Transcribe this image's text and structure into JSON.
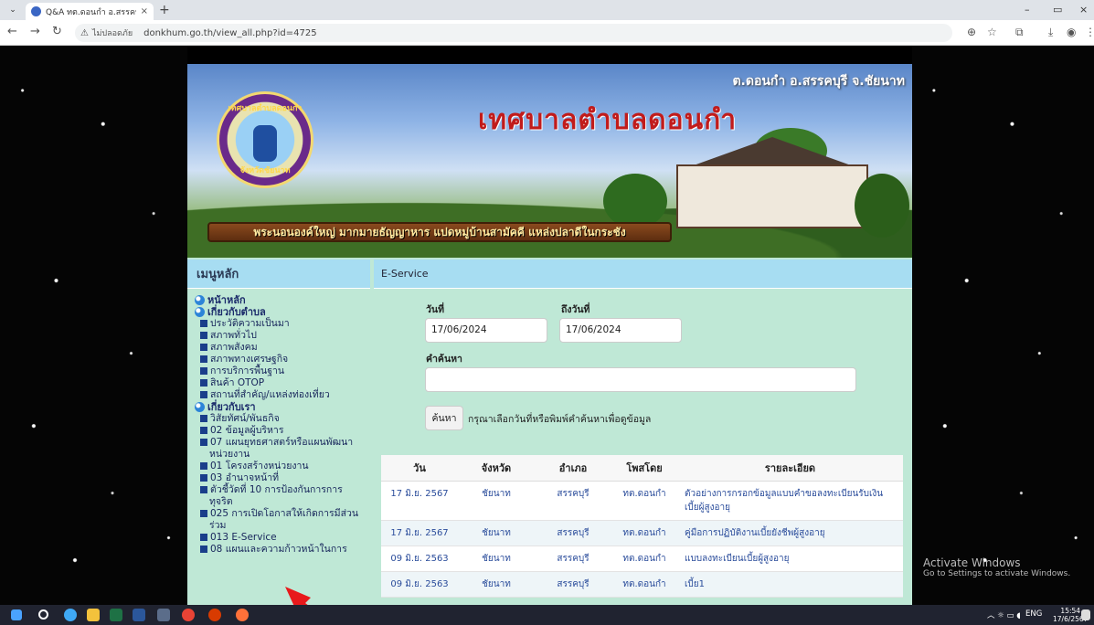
{
  "browser": {
    "tab_title": "Q&A ทต.ดอนกำ อ.สรรคบุรี จ.ชัยนา",
    "tab_close": "×",
    "new_tab": "+",
    "security_label": "ไม่ปลอดภัย",
    "url": "donkhum.go.th/view_all.php?id=4725",
    "window_controls": [
      "–",
      "▭",
      "×"
    ]
  },
  "banner": {
    "logo_top_text": "เทศบาลตำบลดอนกำ",
    "logo_bottom_text": "จังหวัดชัยนาท",
    "title": "เทศบาลตำบลดอนกำ",
    "corner_text": "ต.ดอนกำ อ.สรรคบุรี จ.ชัยนาท",
    "motto": "พระนอนองค์ใหญ่ มากมายธัญญาหาร แปดหมู่บ้านสามัคคี แหล่งปลาดีในกระชัง"
  },
  "sidebar": {
    "header": "เมนูหลัก",
    "groups": [
      {
        "label": "หน้าหลัก",
        "items": []
      },
      {
        "label": "เกี่ยวกับตำบล",
        "items": [
          "ประวัติความเป็นมา",
          "สภาพทั่วไป",
          "สภาพสังคม",
          "สภาพทางเศรษฐกิจ",
          "การบริการพื้นฐาน",
          "สินค้า OTOP",
          "สถานที่สำคัญ/แหล่งท่องเที่ยว"
        ]
      },
      {
        "label": "เกี่ยวกับเรา",
        "items": [
          "วิสัยทัศน์/พันธกิจ",
          "02 ข้อมูลผู้บริหาร",
          "07 แผนยุทธศาสตร์หรือแผนพัฒนาหน่วยงาน",
          "01 โครงสร้างหน่วยงาน",
          "03 อำนาจหน้าที่",
          "ตัวชี้วัดที่ 10 การป้องกันการการทุจริต",
          "025 การเปิดโอกาสให้เกิดการมีส่วนร่วม",
          "013 E-Service",
          "08 แผนและความก้าวหน้าในการ"
        ]
      }
    ]
  },
  "content": {
    "header": "E-Service",
    "from_label": "วันที่",
    "to_label": "ถึงวันที่",
    "from_value": "17/06/2024",
    "to_value": "17/06/2024",
    "keyword_label": "คำค้นหา",
    "search_button": "ค้นหา",
    "hint": "กรุณาเลือกวันที่หรือพิมพ์คำค้นหาเพื่อดูข้อมูล",
    "table": {
      "columns": [
        "วัน",
        "จังหวัด",
        "อำเภอ",
        "โพสโดย",
        "รายละเอียด"
      ],
      "rows": [
        [
          "17 มิ.ย. 2567",
          "ชัยนาท",
          "สรรคบุรี",
          "ทต.ดอนกำ",
          "ตัวอย่างการกรอกข้อมูลแบบคำขอลงทะเบียนรับเงินเบี้ยผู้สูงอายุ"
        ],
        [
          "17 มิ.ย. 2567",
          "ชัยนาท",
          "สรรคบุรี",
          "ทต.ดอนกำ",
          "คู่มือการปฏิบัติงานเบี้ยยังชีพผู้สูงอายุ"
        ],
        [
          "09 มิ.ย. 2563",
          "ชัยนาท",
          "สรรคบุรี",
          "ทต.ดอนกำ",
          "แบบลงทะเบียนเบี้ยผู้สูงอายุ"
        ],
        [
          "09 มิ.ย. 2563",
          "ชัยนาท",
          "สรรคบุรี",
          "ทต.ดอนกำ",
          "เบี้ย1"
        ]
      ]
    }
  },
  "watermark": {
    "title": "Activate Windows",
    "subtitle": "Go to Settings to activate Windows."
  },
  "taskbar": {
    "lang": "ENG",
    "time": "15:54",
    "date": "17/6/2567"
  },
  "colors": {
    "accent_red": "#e8191b",
    "header_blue": "#a7ddf2",
    "panel_green": "#bfe8d6",
    "link_blue": "#2a4c9b"
  }
}
